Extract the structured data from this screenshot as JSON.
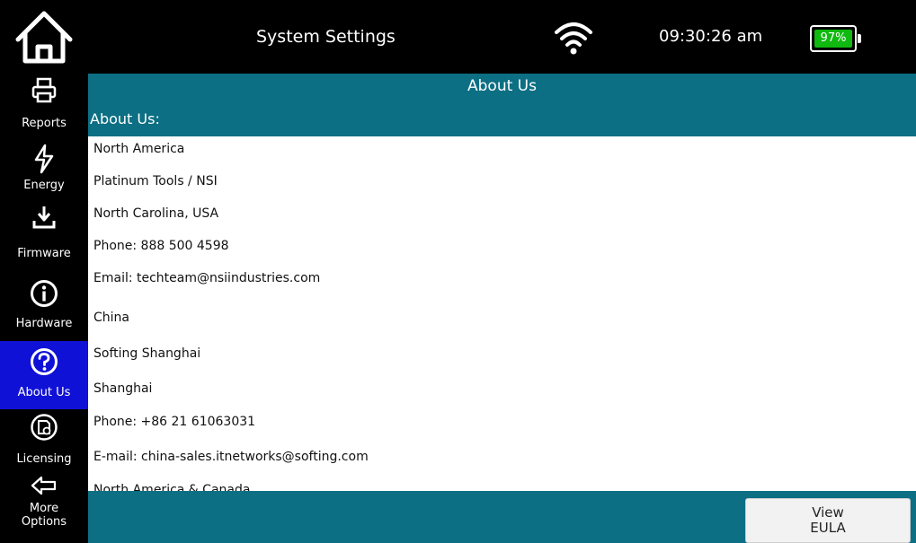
{
  "header": {
    "title": "System Settings",
    "time": "09:30:26 am",
    "battery": "97%",
    "icons": {
      "home": "home-icon",
      "wifi": "wifi-icon",
      "battery": "battery-icon"
    }
  },
  "sidebar": {
    "items": [
      {
        "label": "Reports",
        "icon": "printer-icon",
        "active": false
      },
      {
        "label": "Energy",
        "icon": "lightning-icon",
        "active": false
      },
      {
        "label": "Firmware",
        "icon": "download-icon",
        "active": false
      },
      {
        "label": "Hardware",
        "icon": "info-icon",
        "active": false
      },
      {
        "label": "About Us",
        "icon": "question-icon",
        "active": true
      },
      {
        "label": "Licensing",
        "icon": "license-icon",
        "active": false
      },
      {
        "label": "More",
        "label2": "Options",
        "icon": "back-arrow-icon",
        "active": false
      }
    ]
  },
  "section": {
    "title": "About Us",
    "subtitle": "About Us:"
  },
  "content": {
    "lines": [
      "North America",
      "Platinum Tools / NSI",
      "North Carolina, USA",
      "Phone: 888 500 4598",
      "Email: techteam@nsiindustries.com",
      "China",
      "Softing Shanghai",
      "Shanghai",
      "Phone: +86 21 61063031",
      "E-mail: china-sales.itnetworks@softing.com",
      "North America & Canada"
    ]
  },
  "footer": {
    "eula_line1": "View",
    "eula_line2": "EULA"
  },
  "colors": {
    "accent": "#0d6f84",
    "active_nav": "#1011d6",
    "battery": "#0fb90f"
  }
}
